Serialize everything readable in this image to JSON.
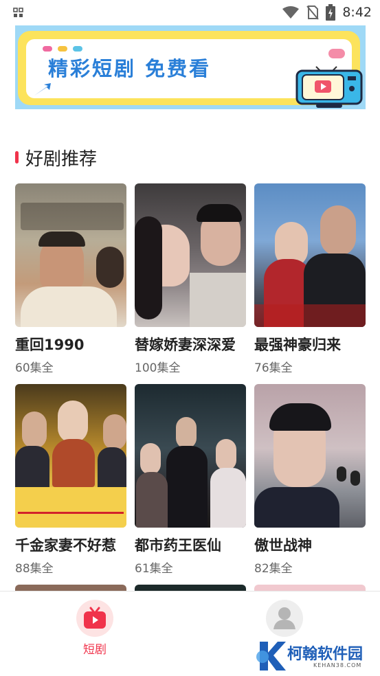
{
  "status_bar": {
    "time": "8:42"
  },
  "banner": {
    "title": "精彩短剧 免费看"
  },
  "section": {
    "title": "好剧推荐"
  },
  "dramas": [
    {
      "title": "重回1990",
      "episodes": "60集全"
    },
    {
      "title": "替嫁娇妻深深爱",
      "episodes": "100集全"
    },
    {
      "title": "最强神豪归来",
      "episodes": "76集全"
    },
    {
      "title": "千金家妻不好惹",
      "episodes": "88集全"
    },
    {
      "title": "都市药王医仙",
      "episodes": "61集全"
    },
    {
      "title": "傲世战神",
      "episodes": "82集全"
    }
  ],
  "bottom_nav": {
    "tabs": [
      {
        "label": "短剧",
        "icon": "tv-icon",
        "active": true
      },
      {
        "label": "",
        "icon": "user-icon",
        "active": false
      }
    ]
  },
  "watermark": {
    "brand": "柯翰软件园",
    "domain": "KEHAN38.COM"
  },
  "colors": {
    "accent": "#f0334b",
    "banner_bg": "#9fd9f6",
    "banner_frame": "#fce35c",
    "banner_text": "#2a7fd8"
  }
}
